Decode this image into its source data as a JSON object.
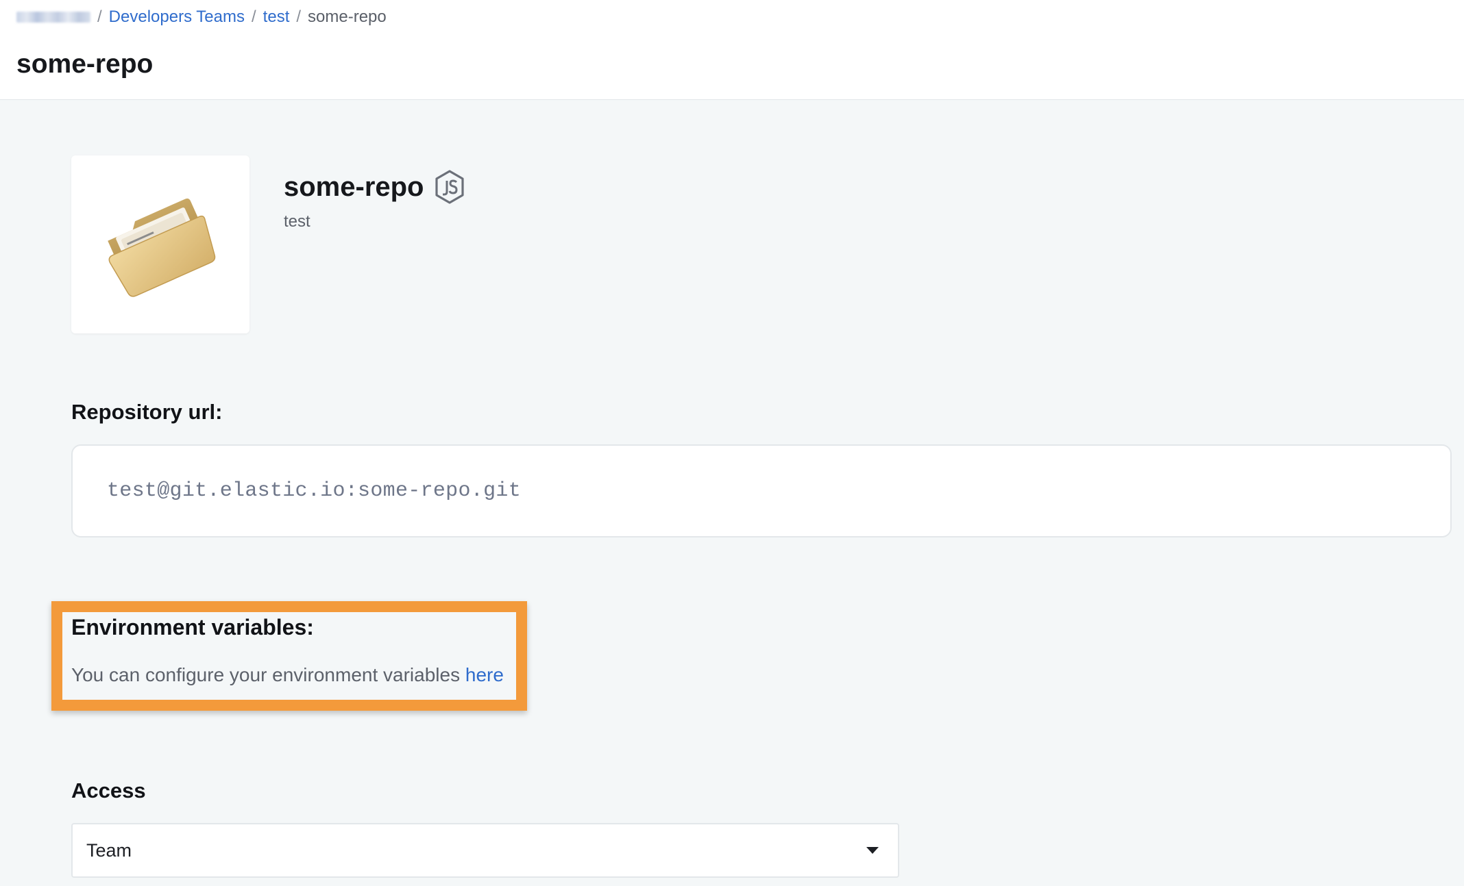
{
  "breadcrumb": {
    "items": [
      {
        "label": "Developers Teams"
      },
      {
        "label": "test"
      }
    ],
    "current": "some-repo",
    "separator": "/"
  },
  "page": {
    "title": "some-repo"
  },
  "repo": {
    "icon": "folder-icon",
    "name": "some-repo",
    "runtime_icon": "nodejs-icon",
    "team": "test"
  },
  "repository_url": {
    "heading": "Repository url:",
    "value": "test@git.elastic.io:some-repo.git"
  },
  "environment": {
    "heading": "Environment variables:",
    "text": "You can configure your environment variables ",
    "link_label": "here"
  },
  "access": {
    "heading": "Access",
    "selected": "Team"
  },
  "colors": {
    "link": "#2f6ccc",
    "highlight_border": "#f39a3b",
    "background": "#f4f7f8"
  }
}
